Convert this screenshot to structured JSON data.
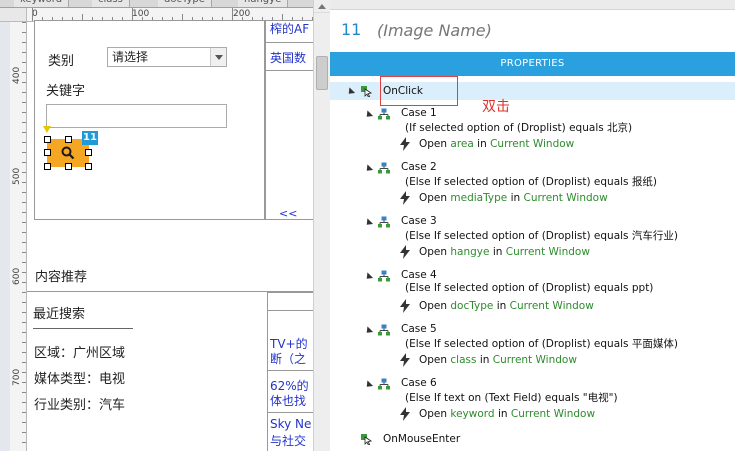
{
  "tabs": [
    "keyword",
    "class",
    "docType",
    "hangye"
  ],
  "ruler_h_labels": [
    "0",
    "100",
    "200"
  ],
  "ruler_v_labels": [
    "400",
    "500",
    "600",
    "700"
  ],
  "canvas": {
    "category_label": "类别",
    "droplist_value": "请选择",
    "keyword_label": "关键字",
    "selection_badge": "11",
    "collapse_link": "<<",
    "content_recommend": "内容推荐",
    "recent_search": "最近搜索",
    "region": "区域：广州区域",
    "media_type": "媒体类型：电视",
    "industry": "行业类别：汽车",
    "link_top1": "榨的AF",
    "link_top2": "英国数",
    "news1_line1": "TV+的",
    "news1_line2": "断（之",
    "news2_line1": "62%的",
    "news2_line2": "体也找",
    "news3_line1": "Sky Ne",
    "news3_line2": "与社交"
  },
  "panel": {
    "page_number": "11",
    "page_name": "(Image Name)",
    "properties_label": "PROPERTIES",
    "double_click_note": "双击",
    "onclick": "OnClick",
    "onmouseenter": "OnMouseEnter",
    "cases": [
      {
        "name": "Case 1",
        "condition": "(If selected option of (Droplist) equals 北京)",
        "open": "Open",
        "target": "area",
        "in": "in",
        "window": "Current Window"
      },
      {
        "name": "Case 2",
        "condition": "(Else If selected option of (Droplist) equals 报纸)",
        "open": "Open",
        "target": "mediaType",
        "in": "in",
        "window": "Current Window"
      },
      {
        "name": "Case 3",
        "condition": "(Else If selected option of (Droplist) equals 汽车行业)",
        "open": "Open",
        "target": "hangye",
        "in": "in",
        "window": "Current Window"
      },
      {
        "name": "Case 4",
        "condition": "(Else If selected option of (Droplist) equals ppt)",
        "open": "Open",
        "target": "docType",
        "in": "in",
        "window": "Current Window"
      },
      {
        "name": "Case 5",
        "condition": "(Else If selected option of (Droplist) equals 平面媒体)",
        "open": "Open",
        "target": "class",
        "in": "in",
        "window": "Current Window"
      },
      {
        "name": "Case 6",
        "condition": "(Else If text on (Text Field) equals \"电视\")",
        "open": "Open",
        "target": "keyword",
        "in": "in",
        "window": "Current Window"
      }
    ]
  },
  "colors": {
    "accent": "#2aa1de",
    "action_green": "#2e8b2e",
    "button_orange": "#f5a623",
    "note_red": "#e0302a"
  }
}
